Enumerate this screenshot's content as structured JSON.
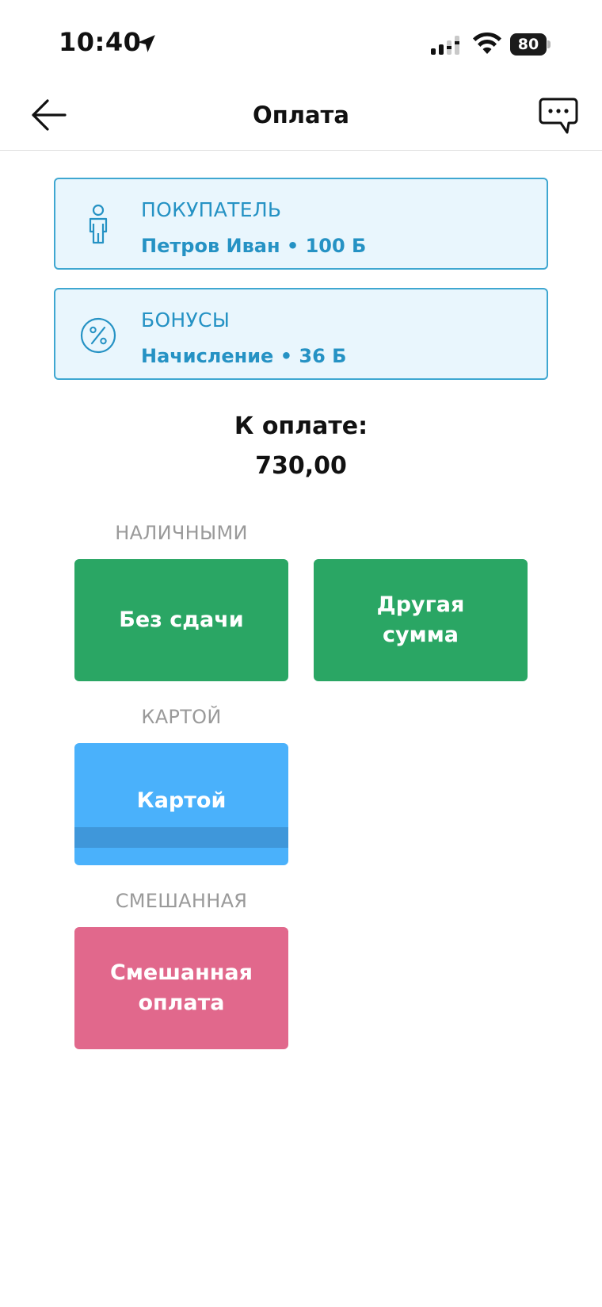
{
  "status_bar": {
    "time": "10:40",
    "battery": "80",
    "icons": [
      "location-arrow-icon",
      "cellular-signal-icon",
      "wifi-icon",
      "battery-icon"
    ]
  },
  "header": {
    "title": "Оплата",
    "back_icon": "arrow-left-icon",
    "chat_icon": "chat-bubble-icon"
  },
  "buyer_card": {
    "label": "ПОКУПАТЕЛЬ",
    "value": "Петров Иван • 100 Б",
    "icon": "person-icon"
  },
  "bonus_card": {
    "label": "БОНУСЫ",
    "value": "Начисление • 36 Б",
    "icon": "percent-icon"
  },
  "amount": {
    "label": "К оплате:",
    "value": "730,00"
  },
  "sections": {
    "cash": {
      "label": "НАЛИЧНЫМИ",
      "buttons": [
        {
          "label": "Без сдачи"
        },
        {
          "label": "Другая\nсумма"
        }
      ]
    },
    "card": {
      "label": "КАРТОЙ",
      "buttons": [
        {
          "label": "Картой"
        }
      ]
    },
    "mixed": {
      "label": "СМЕШАННАЯ",
      "buttons": [
        {
          "label": "Смешанная\nоплата"
        }
      ]
    }
  },
  "colors": {
    "cash_button": "#2aa664",
    "card_button": "#4ab1fb",
    "mixed_button": "#e1688c",
    "info_accent": "#2592c4",
    "info_background": "#e9f6fd"
  }
}
